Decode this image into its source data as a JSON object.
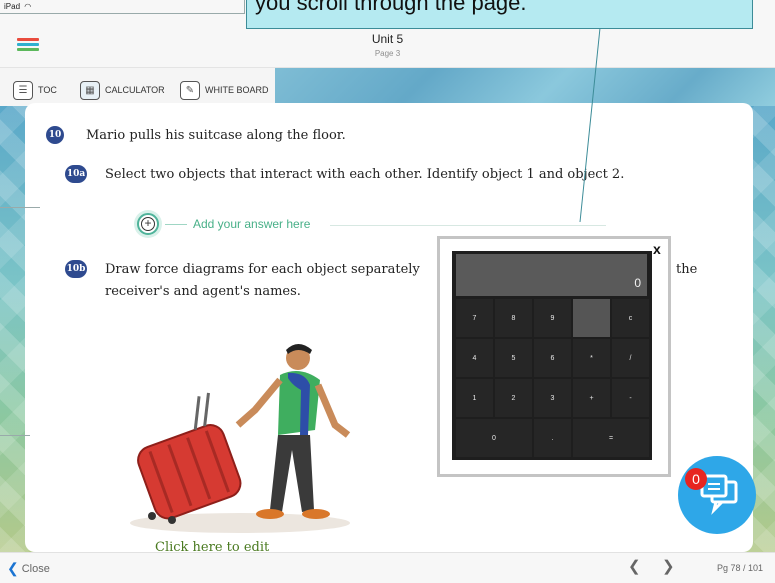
{
  "status_bar": {
    "device": "iPad",
    "wifi_icon": "wifi-icon"
  },
  "callout": {
    "text": "you scroll through the page."
  },
  "header": {
    "title": "Unit 5",
    "subtitle": "Page 3",
    "menu_colors": [
      "#e94c3d",
      "#2fb0d0",
      "#5cb85c"
    ]
  },
  "toolbar": {
    "items": [
      {
        "label": "TOC",
        "icon": "toc-icon"
      },
      {
        "label": "CALCULATOR",
        "icon": "calculator-icon"
      },
      {
        "label": "WHITE BOARD",
        "icon": "whiteboard-icon"
      }
    ]
  },
  "questions": {
    "q10": {
      "badge": "10",
      "text": "Mario pulls his suitcase along the floor."
    },
    "q10a": {
      "badge": "10a",
      "text": "Select two objects that interact with each other. Identify object 1 and object 2."
    },
    "add_answer": "Add your answer here",
    "q10b": {
      "badge": "10b",
      "text_line1": "Draw force diagrams for each object separately",
      "text_end": "the",
      "text_line2": "receiver's and agent's names."
    },
    "cut_text": "Click here to edit"
  },
  "calculator": {
    "close": "x",
    "display": "0",
    "keys": [
      [
        "7",
        "8",
        "9",
        "",
        "c"
      ],
      [
        "4",
        "5",
        "6",
        "*",
        "/"
      ],
      [
        "1",
        "2",
        "3",
        "+",
        "-"
      ],
      [
        "0",
        ".",
        "="
      ]
    ]
  },
  "chat": {
    "badge": "0",
    "icon": "chat-icon"
  },
  "bottom": {
    "close": "Close",
    "page": "Pg 78 / 101"
  }
}
